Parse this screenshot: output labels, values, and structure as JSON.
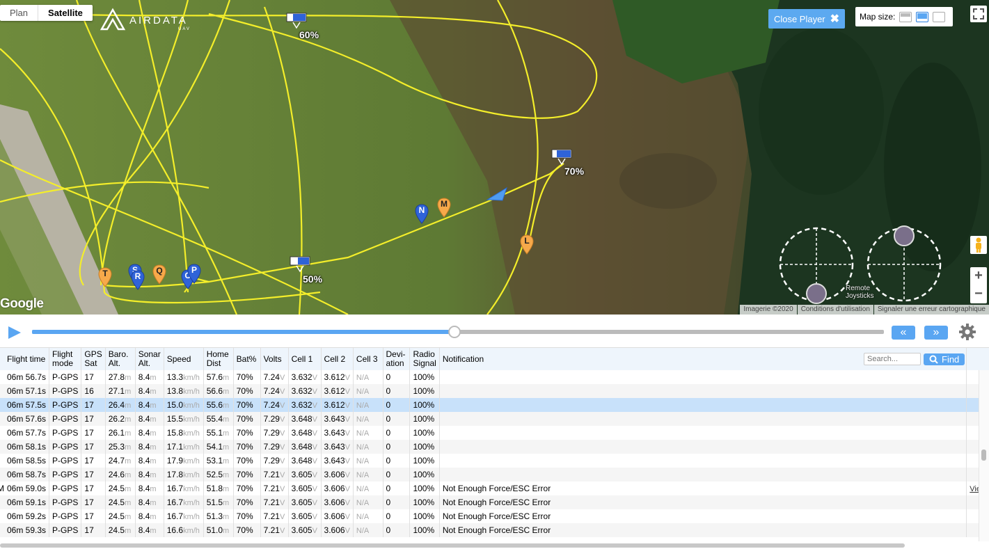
{
  "map": {
    "tabs": [
      "Plan",
      "Satellite"
    ],
    "active_tab": "Satellite",
    "logo": {
      "name": "AIRDATA",
      "sub": "UAV"
    },
    "close_player": "Close Player",
    "map_size_label": "Map size:",
    "map_size_selected": "medium",
    "battery_labels": [
      "60%",
      "70%",
      "50%"
    ],
    "markers": [
      {
        "letter": "N",
        "color": "blue"
      },
      {
        "letter": "M",
        "color": "orange"
      },
      {
        "letter": "L",
        "color": "orange"
      },
      {
        "letter": "T",
        "color": "orange"
      },
      {
        "letter": "S",
        "color": "blue"
      },
      {
        "letter": "R",
        "color": "blue"
      },
      {
        "letter": "Q",
        "color": "orange"
      },
      {
        "letter": "O",
        "color": "blue"
      },
      {
        "letter": "P",
        "color": "blue"
      }
    ],
    "joystick_label": "Remote\nJoysticks",
    "google": "Google",
    "attribution": [
      "Imagerie ©2020",
      "Conditions d'utilisation",
      "Signaler une erreur cartographique"
    ],
    "colors": {
      "track": "#f4ee2a",
      "accent": "#5aa6f2",
      "marker_blue": "#2f63d8",
      "marker_orange": "#f7a94a"
    }
  },
  "player": {
    "progress": 0.494,
    "rewind_icon": "double-left-chevron-icon",
    "forward_icon": "double-right-chevron-icon",
    "settings_icon": "gear-icon"
  },
  "table": {
    "headers": {
      "flight_time": "Flight time",
      "flight_mode": [
        "Flight",
        "mode"
      ],
      "gps": [
        "GPS",
        "Sat"
      ],
      "baro": [
        "Baro.",
        "Alt."
      ],
      "sonar": [
        "Sonar",
        "Alt."
      ],
      "speed": "Speed",
      "home": [
        "Home",
        "Dist"
      ],
      "bat": "Bat%",
      "volts": "Volts",
      "cell1": "Cell 1",
      "cell2": "Cell 2",
      "cell3": "Cell 3",
      "deviation": [
        "Devi-",
        "ation"
      ],
      "radio": [
        "Radio",
        "Signal"
      ],
      "notification": "Notification"
    },
    "search_placeholder": "Search...",
    "find_label": "Find",
    "units": {
      "alt": "m",
      "speed": "km/h",
      "volt": "V"
    },
    "na": "N/A",
    "view_label": "View",
    "row_prefix": "M",
    "rows": [
      {
        "time": "06m 56.7s",
        "mode": "P-GPS",
        "gps": "17",
        "baro": "27.8",
        "sonar": "8.4",
        "speed": "13.3",
        "home": "57.6",
        "bat": "70%",
        "volts": "7.24",
        "cell1": "3.632",
        "cell2": "3.612",
        "dev": "0",
        "radio": "100%",
        "note": ""
      },
      {
        "time": "06m 57.1s",
        "mode": "P-GPS",
        "gps": "16",
        "baro": "27.1",
        "sonar": "8.4",
        "speed": "13.8",
        "home": "56.6",
        "bat": "70%",
        "volts": "7.24",
        "cell1": "3.632",
        "cell2": "3.612",
        "dev": "0",
        "radio": "100%",
        "note": ""
      },
      {
        "time": "06m 57.5s",
        "mode": "P-GPS",
        "gps": "17",
        "baro": "26.4",
        "sonar": "8.4",
        "speed": "15.0",
        "home": "55.6",
        "bat": "70%",
        "volts": "7.24",
        "cell1": "3.632",
        "cell2": "3.612",
        "dev": "0",
        "radio": "100%",
        "note": "",
        "selected": true
      },
      {
        "time": "06m 57.6s",
        "mode": "P-GPS",
        "gps": "17",
        "baro": "26.2",
        "sonar": "8.4",
        "speed": "15.5",
        "home": "55.4",
        "bat": "70%",
        "volts": "7.29",
        "cell1": "3.648",
        "cell2": "3.643",
        "dev": "0",
        "radio": "100%",
        "note": ""
      },
      {
        "time": "06m 57.7s",
        "mode": "P-GPS",
        "gps": "17",
        "baro": "26.1",
        "sonar": "8.4",
        "speed": "15.8",
        "home": "55.1",
        "bat": "70%",
        "volts": "7.29",
        "cell1": "3.648",
        "cell2": "3.643",
        "dev": "0",
        "radio": "100%",
        "note": ""
      },
      {
        "time": "06m 58.1s",
        "mode": "P-GPS",
        "gps": "17",
        "baro": "25.3",
        "sonar": "8.4",
        "speed": "17.1",
        "home": "54.1",
        "bat": "70%",
        "volts": "7.29",
        "cell1": "3.648",
        "cell2": "3.643",
        "dev": "0",
        "radio": "100%",
        "note": ""
      },
      {
        "time": "06m 58.5s",
        "mode": "P-GPS",
        "gps": "17",
        "baro": "24.7",
        "sonar": "8.4",
        "speed": "17.9",
        "home": "53.1",
        "bat": "70%",
        "volts": "7.29",
        "cell1": "3.648",
        "cell2": "3.643",
        "dev": "0",
        "radio": "100%",
        "note": ""
      },
      {
        "time": "06m 58.7s",
        "mode": "P-GPS",
        "gps": "17",
        "baro": "24.6",
        "sonar": "8.4",
        "speed": "17.8",
        "home": "52.5",
        "bat": "70%",
        "volts": "7.21",
        "cell1": "3.605",
        "cell2": "3.606",
        "dev": "0",
        "radio": "100%",
        "note": ""
      },
      {
        "time": "06m 59.0s",
        "mode": "P-GPS",
        "gps": "17",
        "baro": "24.5",
        "sonar": "8.4",
        "speed": "16.7",
        "home": "51.8",
        "bat": "70%",
        "volts": "7.21",
        "cell1": "3.605",
        "cell2": "3.606",
        "dev": "0",
        "radio": "100%",
        "note": "Not Enough Force/ESC Error",
        "view": true,
        "prefix": true
      },
      {
        "time": "06m 59.1s",
        "mode": "P-GPS",
        "gps": "17",
        "baro": "24.5",
        "sonar": "8.4",
        "speed": "16.7",
        "home": "51.5",
        "bat": "70%",
        "volts": "7.21",
        "cell1": "3.605",
        "cell2": "3.606",
        "dev": "0",
        "radio": "100%",
        "note": "Not Enough Force/ESC Error"
      },
      {
        "time": "06m 59.2s",
        "mode": "P-GPS",
        "gps": "17",
        "baro": "24.5",
        "sonar": "8.4",
        "speed": "16.7",
        "home": "51.3",
        "bat": "70%",
        "volts": "7.21",
        "cell1": "3.605",
        "cell2": "3.606",
        "dev": "0",
        "radio": "100%",
        "note": "Not Enough Force/ESC Error"
      },
      {
        "time": "06m 59.3s",
        "mode": "P-GPS",
        "gps": "17",
        "baro": "24.5",
        "sonar": "8.4",
        "speed": "16.6",
        "home": "51.0",
        "bat": "70%",
        "volts": "7.21",
        "cell1": "3.605",
        "cell2": "3.606",
        "dev": "0",
        "radio": "100%",
        "note": "Not Enough Force/ESC Error"
      }
    ]
  }
}
